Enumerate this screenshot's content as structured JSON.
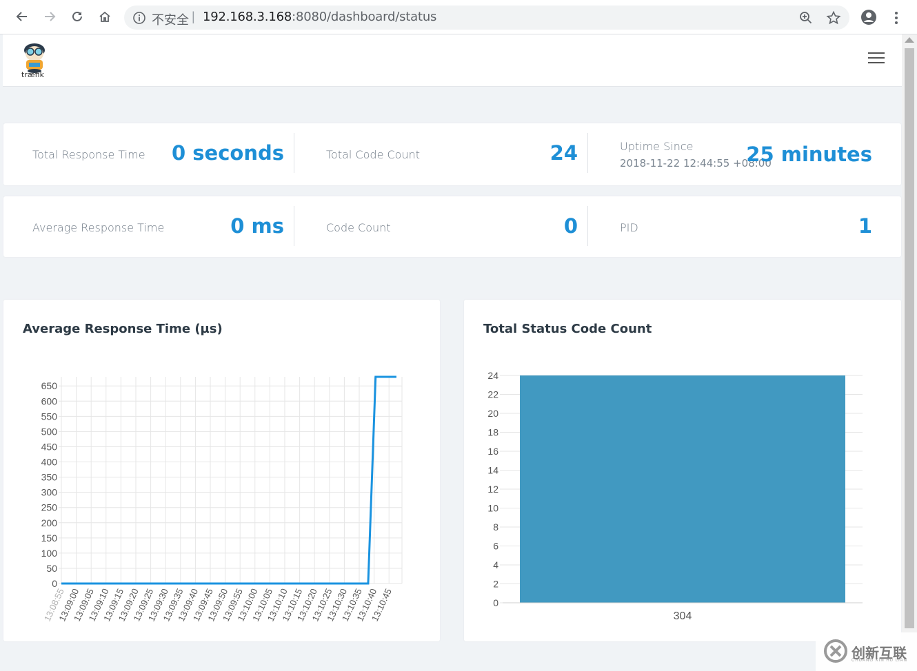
{
  "browser": {
    "security_label": "不安全",
    "separator": "|",
    "url_host": "192.168.3.168",
    "url_rest": ":8080/dashboard/status"
  },
  "app": {
    "logo_text": "træfik"
  },
  "stats_row1": [
    {
      "label": "Total Response Time",
      "value": "0 seconds"
    },
    {
      "label": "Total Code Count",
      "value": "24"
    },
    {
      "label": "Uptime Since",
      "sublabel": "2018-11-22 12:44:55 +08:00",
      "value": "25 minutes"
    }
  ],
  "stats_row2": [
    {
      "label": "Average Response Time",
      "value": "0 ms"
    },
    {
      "label": "Code Count",
      "value": "0"
    },
    {
      "label": "PID",
      "value": "1"
    }
  ],
  "colors": {
    "accent": "#1e8fd6",
    "line": "#1a93e0",
    "bar": "#4199c1"
  },
  "watermark": {
    "text": "创新互联",
    "sub": "CHUANG XIN HU LIAN"
  },
  "chart_data": [
    {
      "type": "line",
      "title": "Average Response Time (µs)",
      "x": [
        "13:08:55",
        "13:09:00",
        "13:09:05",
        "13:09:10",
        "13:09:15",
        "13:09:20",
        "13:09:25",
        "13:09:30",
        "13:09:35",
        "13:09:40",
        "13:09:45",
        "13:09:50",
        "13:09:55",
        "13:10:00",
        "13:10:05",
        "13:10:10",
        "13:10:15",
        "13:10:20",
        "13:10:25",
        "13:10:30",
        "13:10:35",
        "13:10:40",
        "13:10:45"
      ],
      "points": [
        {
          "x": 0,
          "y": 0
        },
        {
          "x": 20.6,
          "y": 0
        },
        {
          "x": 21.1,
          "y": 680
        },
        {
          "x": 22.5,
          "y": 680
        }
      ],
      "yticks": [
        0,
        50,
        100,
        150,
        200,
        250,
        300,
        350,
        400,
        450,
        500,
        550,
        600,
        650
      ],
      "ylim": [
        0,
        680
      ],
      "grid": true
    },
    {
      "type": "bar",
      "title": "Total Status Code Count",
      "categories": [
        "304"
      ],
      "values": [
        24
      ],
      "yticks": [
        0,
        2,
        4,
        6,
        8,
        10,
        12,
        14,
        16,
        18,
        20,
        22,
        24
      ],
      "ylim": [
        0,
        24
      ],
      "grid": true
    }
  ]
}
